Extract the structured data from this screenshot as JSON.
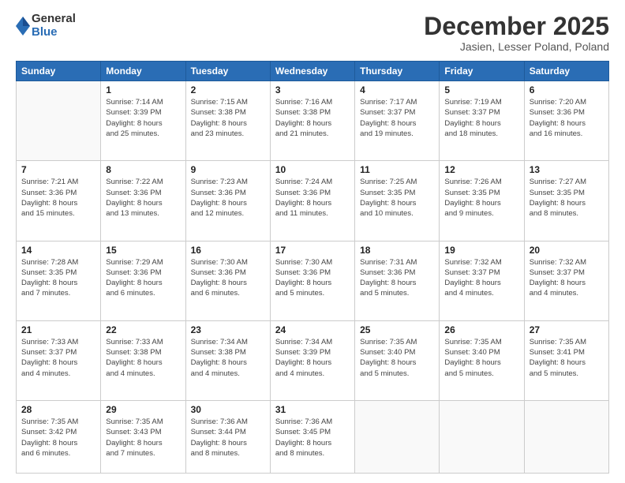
{
  "logo": {
    "general": "General",
    "blue": "Blue"
  },
  "title": "December 2025",
  "location": "Jasien, Lesser Poland, Poland",
  "days_header": [
    "Sunday",
    "Monday",
    "Tuesday",
    "Wednesday",
    "Thursday",
    "Friday",
    "Saturday"
  ],
  "weeks": [
    [
      {
        "day": "",
        "info": ""
      },
      {
        "day": "1",
        "info": "Sunrise: 7:14 AM\nSunset: 3:39 PM\nDaylight: 8 hours\nand 25 minutes."
      },
      {
        "day": "2",
        "info": "Sunrise: 7:15 AM\nSunset: 3:38 PM\nDaylight: 8 hours\nand 23 minutes."
      },
      {
        "day": "3",
        "info": "Sunrise: 7:16 AM\nSunset: 3:38 PM\nDaylight: 8 hours\nand 21 minutes."
      },
      {
        "day": "4",
        "info": "Sunrise: 7:17 AM\nSunset: 3:37 PM\nDaylight: 8 hours\nand 19 minutes."
      },
      {
        "day": "5",
        "info": "Sunrise: 7:19 AM\nSunset: 3:37 PM\nDaylight: 8 hours\nand 18 minutes."
      },
      {
        "day": "6",
        "info": "Sunrise: 7:20 AM\nSunset: 3:36 PM\nDaylight: 8 hours\nand 16 minutes."
      }
    ],
    [
      {
        "day": "7",
        "info": "Sunrise: 7:21 AM\nSunset: 3:36 PM\nDaylight: 8 hours\nand 15 minutes."
      },
      {
        "day": "8",
        "info": "Sunrise: 7:22 AM\nSunset: 3:36 PM\nDaylight: 8 hours\nand 13 minutes."
      },
      {
        "day": "9",
        "info": "Sunrise: 7:23 AM\nSunset: 3:36 PM\nDaylight: 8 hours\nand 12 minutes."
      },
      {
        "day": "10",
        "info": "Sunrise: 7:24 AM\nSunset: 3:36 PM\nDaylight: 8 hours\nand 11 minutes."
      },
      {
        "day": "11",
        "info": "Sunrise: 7:25 AM\nSunset: 3:35 PM\nDaylight: 8 hours\nand 10 minutes."
      },
      {
        "day": "12",
        "info": "Sunrise: 7:26 AM\nSunset: 3:35 PM\nDaylight: 8 hours\nand 9 minutes."
      },
      {
        "day": "13",
        "info": "Sunrise: 7:27 AM\nSunset: 3:35 PM\nDaylight: 8 hours\nand 8 minutes."
      }
    ],
    [
      {
        "day": "14",
        "info": "Sunrise: 7:28 AM\nSunset: 3:35 PM\nDaylight: 8 hours\nand 7 minutes."
      },
      {
        "day": "15",
        "info": "Sunrise: 7:29 AM\nSunset: 3:36 PM\nDaylight: 8 hours\nand 6 minutes."
      },
      {
        "day": "16",
        "info": "Sunrise: 7:30 AM\nSunset: 3:36 PM\nDaylight: 8 hours\nand 6 minutes."
      },
      {
        "day": "17",
        "info": "Sunrise: 7:30 AM\nSunset: 3:36 PM\nDaylight: 8 hours\nand 5 minutes."
      },
      {
        "day": "18",
        "info": "Sunrise: 7:31 AM\nSunset: 3:36 PM\nDaylight: 8 hours\nand 5 minutes."
      },
      {
        "day": "19",
        "info": "Sunrise: 7:32 AM\nSunset: 3:37 PM\nDaylight: 8 hours\nand 4 minutes."
      },
      {
        "day": "20",
        "info": "Sunrise: 7:32 AM\nSunset: 3:37 PM\nDaylight: 8 hours\nand 4 minutes."
      }
    ],
    [
      {
        "day": "21",
        "info": "Sunrise: 7:33 AM\nSunset: 3:37 PM\nDaylight: 8 hours\nand 4 minutes."
      },
      {
        "day": "22",
        "info": "Sunrise: 7:33 AM\nSunset: 3:38 PM\nDaylight: 8 hours\nand 4 minutes."
      },
      {
        "day": "23",
        "info": "Sunrise: 7:34 AM\nSunset: 3:38 PM\nDaylight: 8 hours\nand 4 minutes."
      },
      {
        "day": "24",
        "info": "Sunrise: 7:34 AM\nSunset: 3:39 PM\nDaylight: 8 hours\nand 4 minutes."
      },
      {
        "day": "25",
        "info": "Sunrise: 7:35 AM\nSunset: 3:40 PM\nDaylight: 8 hours\nand 5 minutes."
      },
      {
        "day": "26",
        "info": "Sunrise: 7:35 AM\nSunset: 3:40 PM\nDaylight: 8 hours\nand 5 minutes."
      },
      {
        "day": "27",
        "info": "Sunrise: 7:35 AM\nSunset: 3:41 PM\nDaylight: 8 hours\nand 5 minutes."
      }
    ],
    [
      {
        "day": "28",
        "info": "Sunrise: 7:35 AM\nSunset: 3:42 PM\nDaylight: 8 hours\nand 6 minutes."
      },
      {
        "day": "29",
        "info": "Sunrise: 7:35 AM\nSunset: 3:43 PM\nDaylight: 8 hours\nand 7 minutes."
      },
      {
        "day": "30",
        "info": "Sunrise: 7:36 AM\nSunset: 3:44 PM\nDaylight: 8 hours\nand 8 minutes."
      },
      {
        "day": "31",
        "info": "Sunrise: 7:36 AM\nSunset: 3:45 PM\nDaylight: 8 hours\nand 8 minutes."
      },
      {
        "day": "",
        "info": ""
      },
      {
        "day": "",
        "info": ""
      },
      {
        "day": "",
        "info": ""
      }
    ]
  ]
}
